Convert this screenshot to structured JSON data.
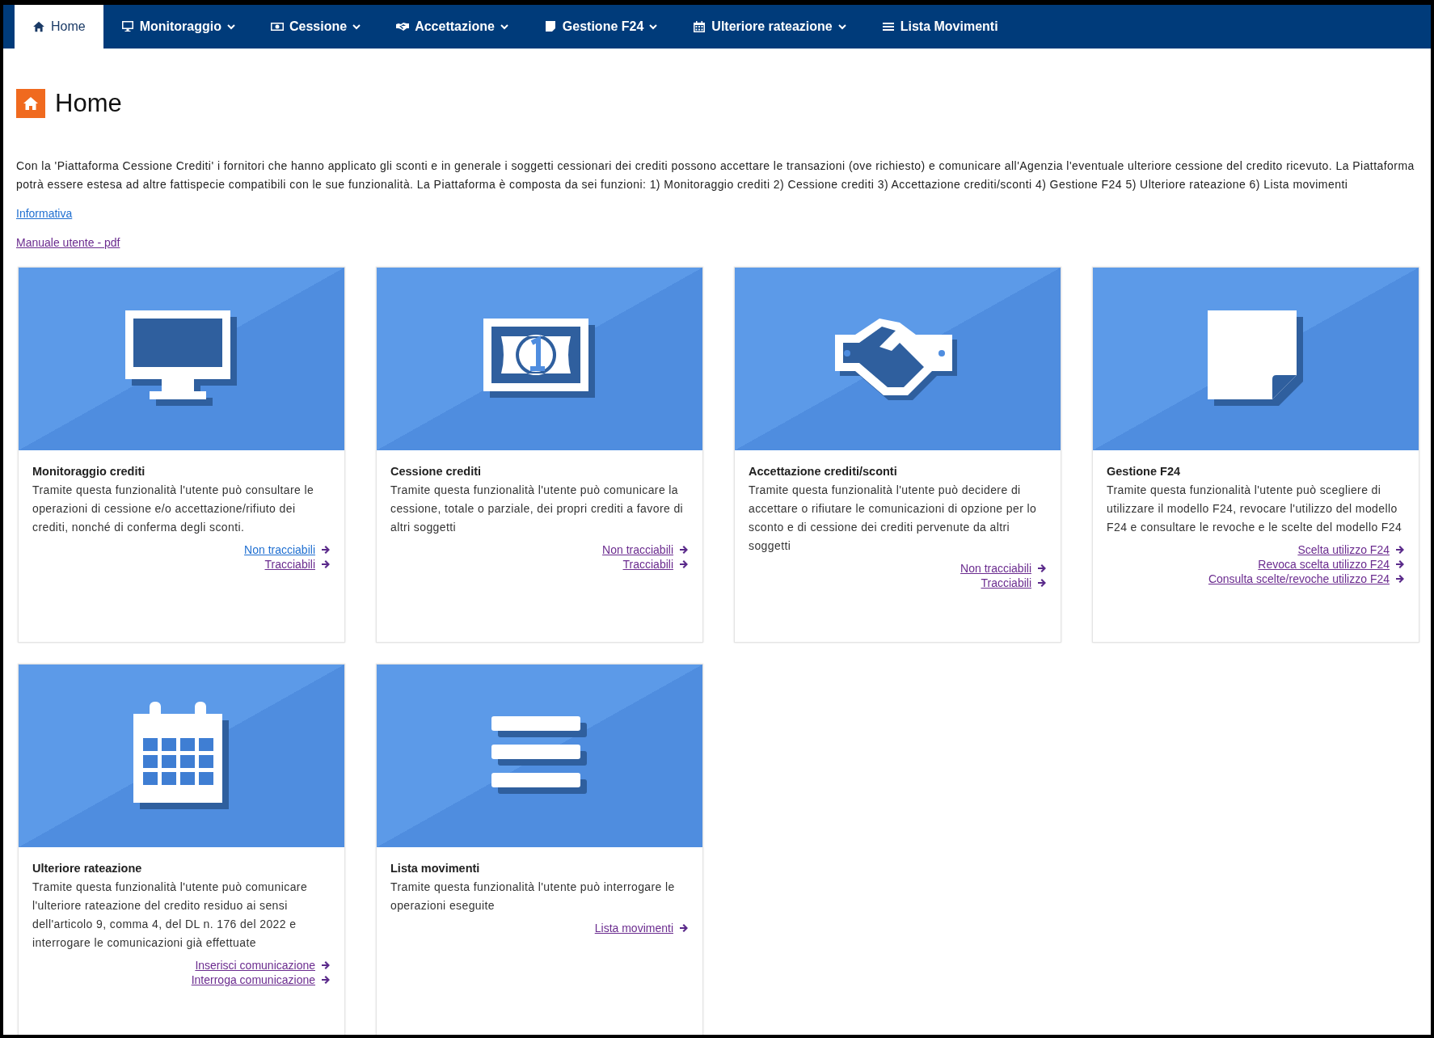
{
  "nav": [
    {
      "label": "Home",
      "selected": true,
      "dropdown": false
    },
    {
      "label": "Monitoraggio",
      "selected": false,
      "dropdown": true
    },
    {
      "label": "Cessione",
      "selected": false,
      "dropdown": true
    },
    {
      "label": "Accettazione",
      "selected": false,
      "dropdown": true
    },
    {
      "label": "Gestione F24",
      "selected": false,
      "dropdown": true
    },
    {
      "label": "Ulteriore rateazione",
      "selected": false,
      "dropdown": true
    },
    {
      "label": "Lista Movimenti",
      "selected": false,
      "dropdown": false
    }
  ],
  "page_title": "Home",
  "intro": "Con la 'Piattaforma Cessione Crediti' i fornitori che hanno applicato gli sconti e in generale i soggetti cessionari dei crediti possono accettare le transazioni (ove richiesto) e comunicare all'Agenzia l'eventuale ulteriore cessione del credito ricevuto. La Piattaforma potrà essere estesa ad altre fattispecie compatibili con le sue funzionalità. La Piattaforma è composta da sei funzioni: 1) Monitoraggio crediti 2) Cessione crediti 3) Accettazione crediti/sconti 4) Gestione F24 5) Ulteriore rateazione 6) Lista movimenti",
  "doc_links": [
    {
      "label": "Informativa",
      "visited": false
    },
    {
      "label": "Manuale utente - pdf",
      "visited": true
    }
  ],
  "cards": [
    {
      "title": "Monitoraggio crediti",
      "text": "Tramite questa funzionalità l'utente può consultare le operazioni di cessione e/o accettazione/rifiuto dei crediti, nonché di conferma degli sconti.",
      "links": [
        {
          "label": "Non tracciabili",
          "visited": false
        },
        {
          "label": "Tracciabili",
          "visited": true
        }
      ]
    },
    {
      "title": "Cessione crediti",
      "text": "Tramite questa funzionalità l'utente può comunicare la cessione, totale o parziale, dei propri crediti a favore di altri soggetti",
      "links": [
        {
          "label": "Non tracciabili",
          "visited": true
        },
        {
          "label": "Tracciabili",
          "visited": true
        }
      ]
    },
    {
      "title": "Accettazione crediti/sconti",
      "text": "Tramite questa funzionalità l'utente può decidere di accettare o rifiutare le comunicazioni di opzione per lo sconto e di cessione dei crediti pervenute da altri soggetti",
      "links": [
        {
          "label": "Non tracciabili",
          "visited": true
        },
        {
          "label": "Tracciabili",
          "visited": true
        }
      ]
    },
    {
      "title": "Gestione F24",
      "text": "Tramite questa funzionalità l'utente può scegliere di utilizzare il modello F24, revocare l'utilizzo del modello F24 e consultare le revoche e le scelte del modello F24",
      "links": [
        {
          "label": "Scelta utilizzo F24",
          "visited": true
        },
        {
          "label": "Revoca scelta utilizzo F24",
          "visited": true
        },
        {
          "label": "Consulta scelte/revoche utilizzo F24",
          "visited": true
        }
      ]
    },
    {
      "title": "Ulteriore rateazione",
      "text": "Tramite questa funzionalità l'utente può comunicare l'ulteriore rateazione del credito residuo ai sensi dell'articolo 9, comma 4, del DL n. 176 del 2022 e interrogare le comunicazioni già effettuate",
      "links": [
        {
          "label": "Inserisci comunicazione",
          "visited": true
        },
        {
          "label": "Interroga comunicazione",
          "visited": true
        }
      ]
    },
    {
      "title": "Lista movimenti",
      "text": "Tramite questa funzionalità l'utente può interrogare le operazioni eseguite",
      "links": [
        {
          "label": "Lista movimenti",
          "visited": true
        }
      ]
    }
  ]
}
